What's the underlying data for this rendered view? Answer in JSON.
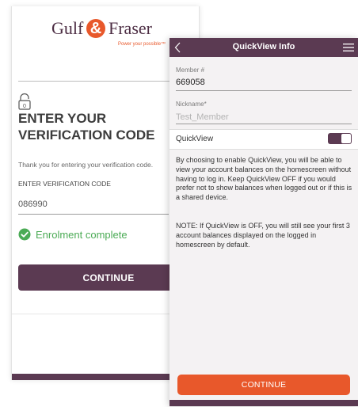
{
  "verification_screen": {
    "logo": {
      "word_left": "Gulf",
      "ampersand": "&",
      "word_right": "Fraser",
      "tagline": "Power your possible™",
      "brand_color": "#4d2e44",
      "accent_color": "#e8582b"
    },
    "lock_icon": "lock-icon",
    "heading": "ENTER YOUR VERIFICATION CODE",
    "thanks_text": "Thank you for entering your verification code.",
    "code_label": "ENTER VERIFICATION CODE",
    "code_value": "086990",
    "status_icon": "check-circle-icon",
    "status_text": "Enrolment complete",
    "status_color": "#4bab55",
    "continue_label": "CONTINUE",
    "button_color": "#5b3a52"
  },
  "quickview_screen": {
    "nav": {
      "back_icon": "chevron-left-icon",
      "title": "QuickView Info",
      "menu_icon": "hamburger-menu-icon",
      "bar_color": "#5b3a52"
    },
    "member": {
      "label": "Member #",
      "value": "669058"
    },
    "nickname": {
      "label": "Nickname*",
      "value": "",
      "placeholder": "Test_Member"
    },
    "quickview_toggle": {
      "label": "QuickView",
      "state": "on"
    },
    "description": "By choosing to enable QuickView, you will be able to view your account balances on the homescreen without having to log in. Keep QuickView OFF if you would prefer not to show balances when logged out or if this is a shared device.",
    "note": "NOTE: If QuickView is OFF, you will still see your first 3 account balances displayed on the logged in homescreen by default.",
    "continue_label": "CONTINUE",
    "button_color": "#e8582b"
  }
}
